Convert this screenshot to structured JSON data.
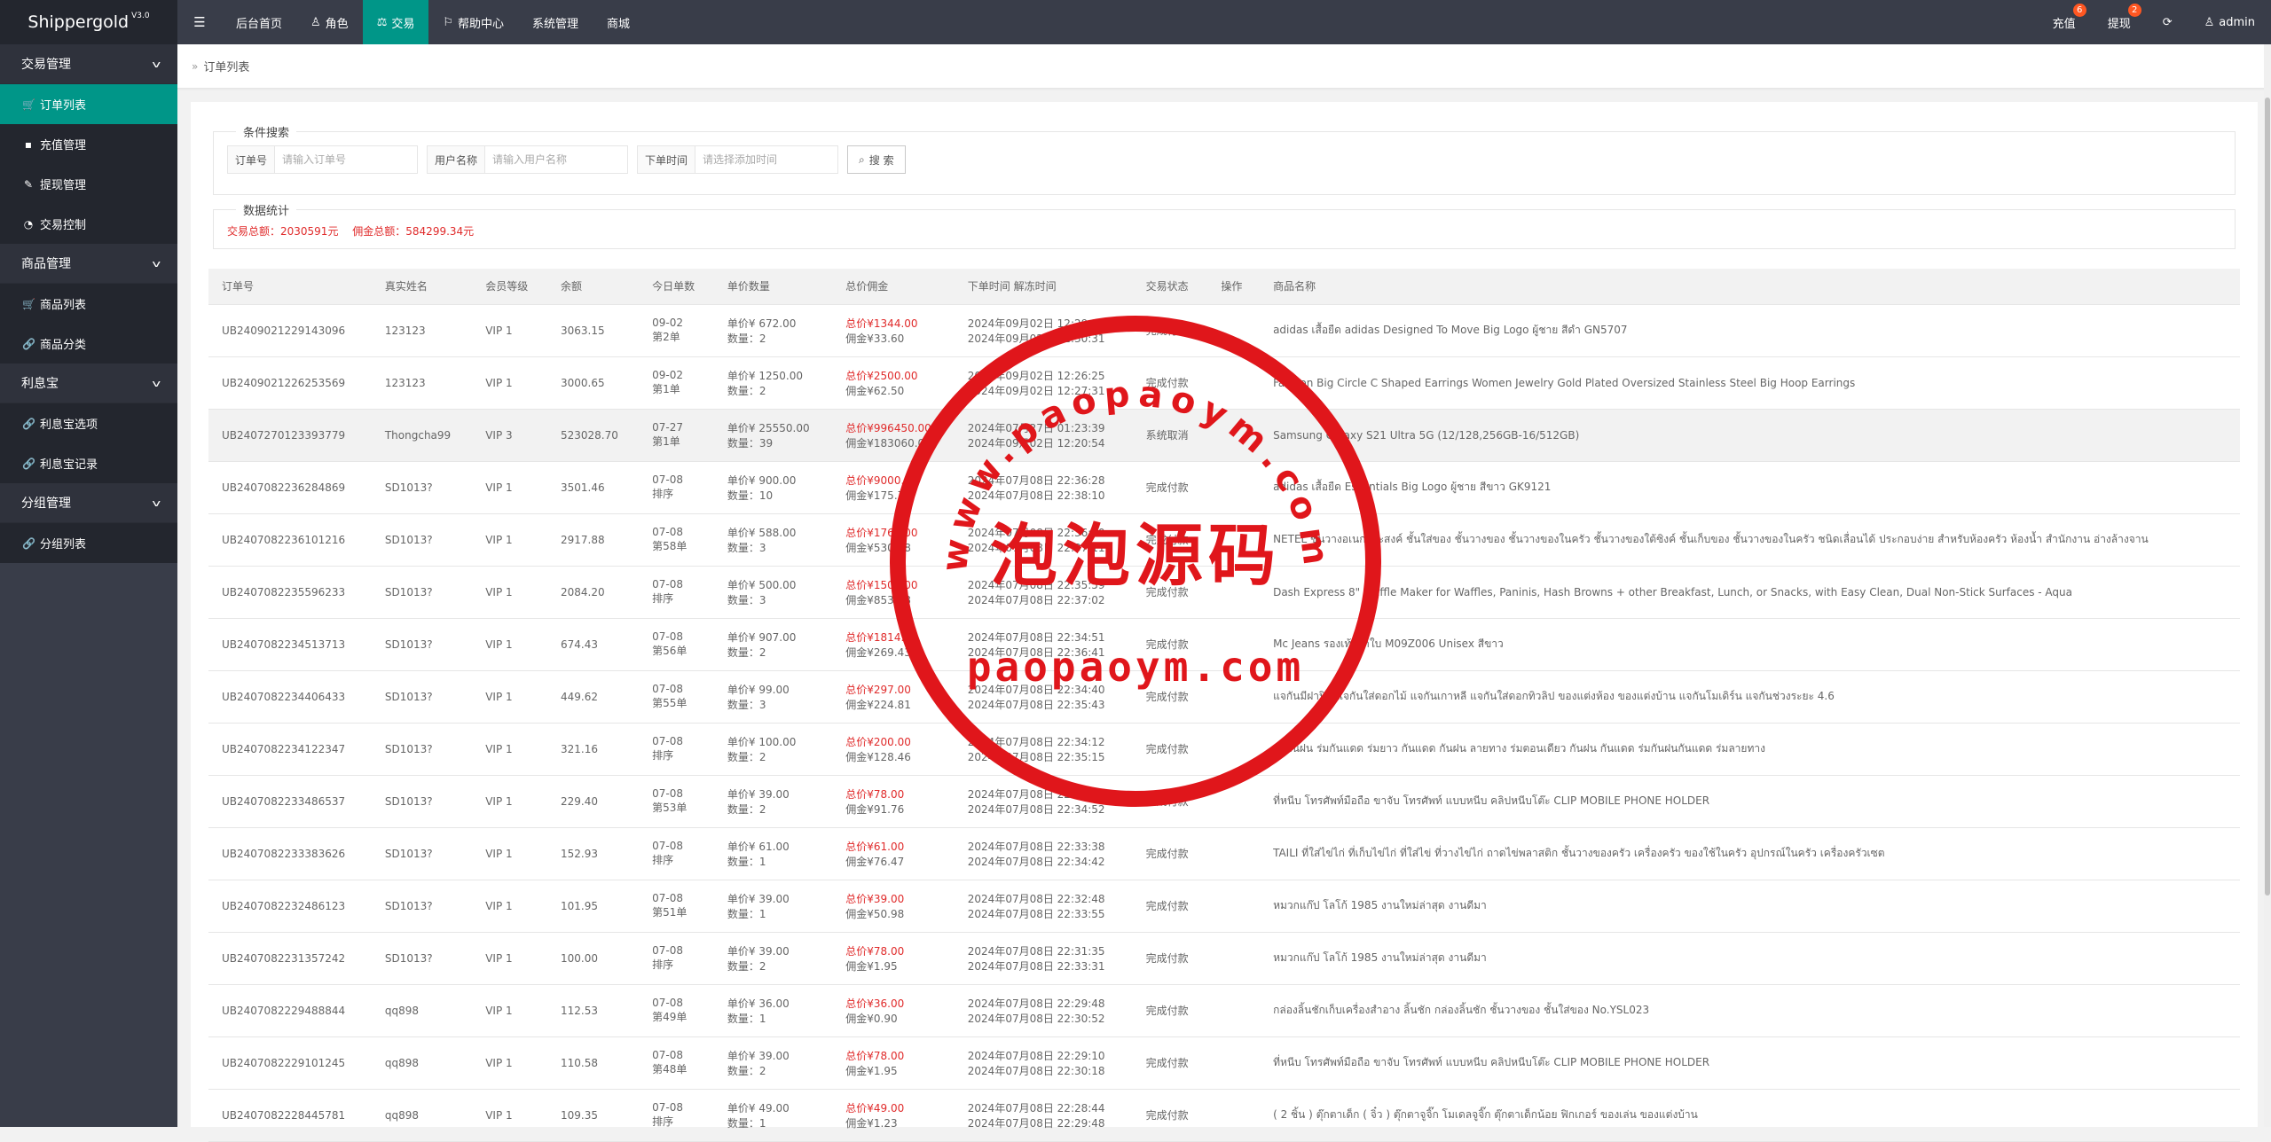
{
  "app": {
    "name": "Shippergold",
    "version": "V3.0"
  },
  "topnav": {
    "menu_icon": "hamburger-icon",
    "items": [
      {
        "label": "后台首页",
        "icon": ""
      },
      {
        "label": "角色",
        "icon": "user-icon"
      },
      {
        "label": "交易",
        "icon": "scale-icon",
        "active": true
      },
      {
        "label": "帮助中心",
        "icon": "flag-icon"
      },
      {
        "label": "系统管理",
        "icon": ""
      },
      {
        "label": "商城",
        "icon": ""
      }
    ],
    "right": {
      "recharge": "充值",
      "recharge_badge": "6",
      "withdraw": "提现",
      "withdraw_badge": "2",
      "refresh_icon": "refresh-icon",
      "user": "admin"
    }
  },
  "sidebar": {
    "groups": [
      {
        "label": "交易管理",
        "items": [
          "订单列表",
          "充值管理",
          "提现管理",
          "交易控制"
        ]
      },
      {
        "label": "商品管理",
        "items": [
          "商品列表",
          "商品分类"
        ]
      },
      {
        "label": "利息宝",
        "items": [
          "利息宝选项",
          "利息宝记录"
        ]
      },
      {
        "label": "分组管理",
        "items": [
          "分组列表"
        ]
      }
    ]
  },
  "breadcrumb": "订单列表",
  "search": {
    "legend": "条件搜索",
    "order_no_label": "订单号",
    "order_no_placeholder": "请输入订单号",
    "user_label": "用户名称",
    "user_placeholder": "请输入用户名称",
    "time_label": "下单时间",
    "time_placeholder": "请选择添加时间",
    "button": "搜 索"
  },
  "stats": {
    "legend": "数据统计",
    "total_trade": "交易总额：2030591元",
    "total_commission": "佣金总额：584299.34元"
  },
  "table": {
    "headers": [
      "订单号",
      "真实姓名",
      "会员等级",
      "余额",
      "今日单数",
      "单价数量",
      "总价佣金",
      "下单时间 解冻时间",
      "交易状态",
      "操作",
      "商品名称"
    ],
    "rows": [
      {
        "order": "UB2409021229143096",
        "name": "123123",
        "vip": "VIP 1",
        "balance": "3063.15",
        "date": "09-02",
        "seq": "第2单",
        "price": "单价¥  672.00",
        "qty": "数量：2",
        "total": "总价¥1344.00",
        "comm": "佣金¥33.60",
        "t1": "2024年09月02日 12:29:14",
        "t2": "2024年09月02日 12:30:31",
        "status": "完成付款",
        "product": "adidas เสื้อยืด adidas Designed To Move Big Logo ผู้ชาย สีดำ GN5707"
      },
      {
        "order": "UB2409021226253569",
        "name": "123123",
        "vip": "VIP 1",
        "balance": "3000.65",
        "date": "09-02",
        "seq": "第1单",
        "price": "单价¥  1250.00",
        "qty": "数量：2",
        "total": "总价¥2500.00",
        "comm": "佣金¥62.50",
        "t1": "2024年09月02日 12:26:25",
        "t2": "2024年09月02日 12:27:31",
        "status": "完成付款",
        "product": "Fashion Big Circle C Shaped Earrings Women Jewelry Gold Plated Oversized Stainless Steel Big Hoop Earrings"
      },
      {
        "order": "UB2407270123393779",
        "name": "Thongcha99",
        "vip": "VIP 3",
        "balance": "523028.70",
        "date": "07-27",
        "seq": "第1单",
        "price": "单价¥  25550.00",
        "qty": "数量：39",
        "total": "总价¥996450.00",
        "comm": "佣金¥183060.00",
        "t1": "2024年07月27日 01:23:39",
        "t2": "2024年09月02日 12:20:54",
        "status": "系统取消",
        "product": "Samsung Galaxy S21 Ultra 5G (12/128,256GB-16/512GB)"
      },
      {
        "order": "UB2407082236284869",
        "name": "SD1013?",
        "vip": "VIP 1",
        "balance": "3501.46",
        "date": "07-08",
        "seq": "排序",
        "price": "单价¥  900.00",
        "qty": "数量：10",
        "total": "总价¥9000.00",
        "comm": "佣金¥175.73",
        "t1": "2024年07月08日 22:36:28",
        "t2": "2024年07月08日 22:38:10",
        "status": "完成付款",
        "product": "adidas เสื้อยืด Essentials Big Logo ผู้ชาย สีขาว GK9121"
      },
      {
        "order": "UB2407082236101216",
        "name": "SD1013?",
        "vip": "VIP 1",
        "balance": "2917.88",
        "date": "07-08",
        "seq": "第58单",
        "price": "单价¥  588.00",
        "qty": "数量：3",
        "total": "总价¥1764.00",
        "comm": "佣金¥530.58",
        "t1": "2024年07月08日 22:36:10",
        "t2": "2024年07月08日 22:37:11",
        "status": "完成付款",
        "product": "NETEL ชั้นวางอเนกประสงค์ ชั้นใส่ของ ชั้นวางของ ชั้นวางของในครัว ชั้นวางของใต้ซิงค์ ชั้นเก็บของ ชั้นวางของในครัว ชนิดเลื่อนได้ ประกอบง่าย สำหรับห้องครัว ห้องน้ำ สำนักงาน อ่างล้างจาน"
      },
      {
        "order": "UB2407082235596233",
        "name": "SD1013?",
        "vip": "VIP 1",
        "balance": "2084.20",
        "date": "07-08",
        "seq": "排序",
        "price": "单价¥  500.00",
        "qty": "数量：3",
        "total": "总价¥1500.00",
        "comm": "佣金¥853.68",
        "t1": "2024年07月08日 22:35:59",
        "t2": "2024年07月08日 22:37:02",
        "status": "完成付款",
        "product": "Dash Express 8\" Waffle Maker for Waffles, Paninis, Hash Browns + other Breakfast, Lunch, or Snacks, with Easy Clean, Dual Non-Stick Surfaces - Aqua"
      },
      {
        "order": "UB2407082234513713",
        "name": "SD1013?",
        "vip": "VIP 1",
        "balance": "674.43",
        "date": "07-08",
        "seq": "第56单",
        "price": "单价¥  907.00",
        "qty": "数量：2",
        "total": "总价¥1814.00",
        "comm": "佣金¥269.43",
        "t1": "2024年07月08日 22:34:51",
        "t2": "2024年07月08日 22:36:41",
        "status": "完成付款",
        "product": "Mc Jeans รองเท้าผ้าใบ M09Z006 Unisex สีขาว"
      },
      {
        "order": "UB2407082234406433",
        "name": "SD1013?",
        "vip": "VIP 1",
        "balance": "449.62",
        "date": "07-08",
        "seq": "第55单",
        "price": "单价¥  99.00",
        "qty": "数量：3",
        "total": "总价¥297.00",
        "comm": "佣金¥224.81",
        "t1": "2024年07月08日 22:34:40",
        "t2": "2024年07月08日 22:35:43",
        "status": "完成付款",
        "product": "แจกันมีฝาปิด แจกันใส่ดอกไม้ แจกันเกาหลี แจกันใส่ดอกทิวลิป ของแต่งห้อง ของแต่งบ้าน แจกันโมเดิร์น แจกันช่วงระยะ 4.6"
      },
      {
        "order": "UB2407082234122347",
        "name": "SD1013?",
        "vip": "VIP 1",
        "balance": "321.16",
        "date": "07-08",
        "seq": "排序",
        "price": "单价¥  100.00",
        "qty": "数量：2",
        "total": "总价¥200.00",
        "comm": "佣金¥128.46",
        "t1": "2024年07月08日 22:34:12",
        "t2": "2024年07月08日 22:35:15",
        "status": "完成付款",
        "product": "ร่มกันฝน ร่มกันแดด ร่มยาว กันแดด กันฝน ลายทาง ร่มตอนเดียว กันฝน กันแดด ร่มกันฝนกันแดด ร่มลายทาง"
      },
      {
        "order": "UB2407082233486537",
        "name": "SD1013?",
        "vip": "VIP 1",
        "balance": "229.40",
        "date": "07-08",
        "seq": "第53单",
        "price": "单价¥  39.00",
        "qty": "数量：2",
        "total": "总价¥78.00",
        "comm": "佣金¥91.76",
        "t1": "2024年07月08日 22:33:48",
        "t2": "2024年07月08日 22:34:52",
        "status": "完成付款",
        "product": "ที่หนีบ โทรศัพท์มือถือ ขาจับ โทรศัพท์ แบบหนีบ คลิปหนีบโต๊ะ CLIP MOBILE PHONE HOLDER"
      },
      {
        "order": "UB2407082233383626",
        "name": "SD1013?",
        "vip": "VIP 1",
        "balance": "152.93",
        "date": "07-08",
        "seq": "排序",
        "price": "单价¥  61.00",
        "qty": "数量：1",
        "total": "总价¥61.00",
        "comm": "佣金¥76.47",
        "t1": "2024年07月08日 22:33:38",
        "t2": "2024年07月08日 22:34:42",
        "status": "完成付款",
        "product": "TAILI ที่ใส่ไข่ไก่ ที่เก็บไข่ไก่ ที่ใส่ไข่ ที่วางไข่ไก่ ถาดไข่พลาสติก ชั้นวางของครัว เครื่องครัว ของใช้ในครัว อุปกรณ์ในครัว เครื่องครัวเซต"
      },
      {
        "order": "UB2407082232486123",
        "name": "SD1013?",
        "vip": "VIP 1",
        "balance": "101.95",
        "date": "07-08",
        "seq": "第51单",
        "price": "单价¥  39.00",
        "qty": "数量：1",
        "total": "总价¥39.00",
        "comm": "佣金¥50.98",
        "t1": "2024年07月08日 22:32:48",
        "t2": "2024年07月08日 22:33:55",
        "status": "完成付款",
        "product": "หมวกแก๊ป โลโก้ 1985 งานใหม่ล่าสุด งานดีมา"
      },
      {
        "order": "UB2407082231357242",
        "name": "SD1013?",
        "vip": "VIP 1",
        "balance": "100.00",
        "date": "07-08",
        "seq": "排序",
        "price": "单价¥  39.00",
        "qty": "数量：2",
        "total": "总价¥78.00",
        "comm": "佣金¥1.95",
        "t1": "2024年07月08日 22:31:35",
        "t2": "2024年07月08日 22:33:31",
        "status": "完成付款",
        "product": "หมวกแก๊ป โลโก้ 1985 งานใหม่ล่าสุด งานดีมา"
      },
      {
        "order": "UB2407082229488844",
        "name": "qq898",
        "vip": "VIP 1",
        "balance": "112.53",
        "date": "07-08",
        "seq": "第49单",
        "price": "单价¥  36.00",
        "qty": "数量：1",
        "total": "总价¥36.00",
        "comm": "佣金¥0.90",
        "t1": "2024年07月08日 22:29:48",
        "t2": "2024年07月08日 22:30:52",
        "status": "完成付款",
        "product": "กล่องลิ้นชักเก็บเครื่องสำอาง ลิ้นชัก กล่องลิ้นชัก ชั้นวางของ ชั้นใส่ของ No.YSL023"
      },
      {
        "order": "UB2407082229101245",
        "name": "qq898",
        "vip": "VIP 1",
        "balance": "110.58",
        "date": "07-08",
        "seq": "第48单",
        "price": "单价¥  39.00",
        "qty": "数量：2",
        "total": "总价¥78.00",
        "comm": "佣金¥1.95",
        "t1": "2024年07月08日 22:29:10",
        "t2": "2024年07月08日 22:30:18",
        "status": "完成付款",
        "product": "ที่หนีบ โทรศัพท์มือถือ ขาจับ โทรศัพท์ แบบหนีบ คลิปหนีบโต๊ะ CLIP MOBILE PHONE HOLDER"
      },
      {
        "order": "UB2407082228445781",
        "name": "qq898",
        "vip": "VIP 1",
        "balance": "109.35",
        "date": "07-08",
        "seq": "排序",
        "price": "单价¥  49.00",
        "qty": "数量：1",
        "total": "总价¥49.00",
        "comm": "佣金¥1.23",
        "t1": "2024年07月08日 22:28:44",
        "t2": "2024年07月08日 22:29:48",
        "status": "完成付款",
        "product": "( 2 ชิ้น ) ตุ๊กตาเด็ก ( จิ๋ว ) ตุ๊กตาจูจิ๊ก โมเดลจูจิ๊ก ตุ๊กตาเด็กน้อย ฟิกเกอร์ ของเล่น ของแต่งบ้าน"
      }
    ]
  },
  "watermark": {
    "top": "www.paopaoym.com",
    "middle": "泡泡源码",
    "bottom": "paopaoym.com",
    "color": "#e0161b"
  },
  "colors": {
    "header": "#393d49",
    "accent": "#009688",
    "badge": "#ff5722",
    "red": "#e02b2b"
  }
}
